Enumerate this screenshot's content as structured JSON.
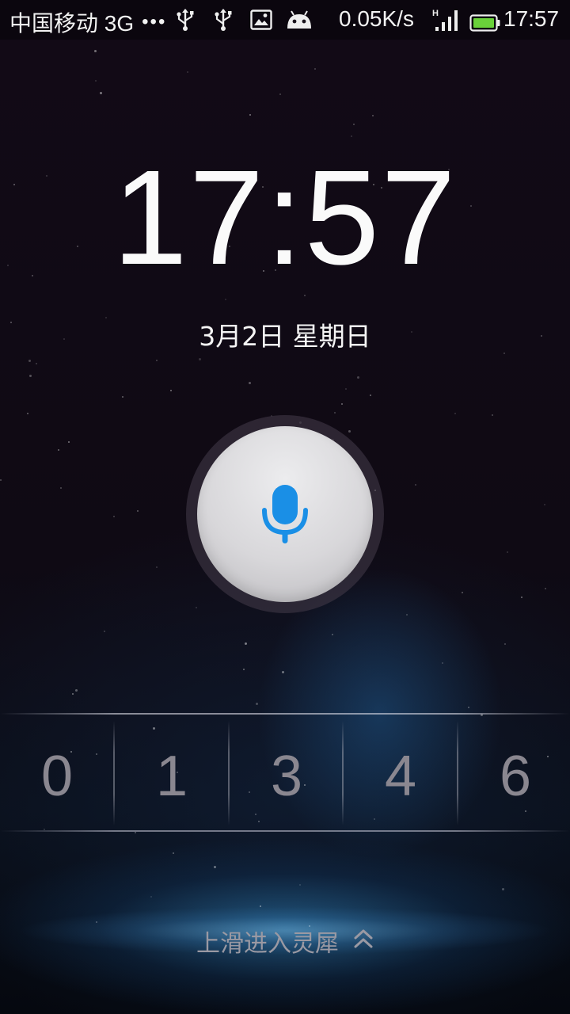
{
  "status_bar": {
    "carrier": "中国移动 3G",
    "more_dots": "•••",
    "network_speed": "0.05K/s",
    "network_type": "H",
    "time": "17:57",
    "icons": [
      "usb-icon",
      "usb-icon",
      "image-icon",
      "android-icon",
      "signal-icon",
      "battery-icon"
    ],
    "battery_color": "#6ad23a"
  },
  "lockscreen": {
    "clock": "17:57",
    "date": "3月2日 星期日",
    "mic_color": "#1a8fe6",
    "digits": [
      "0",
      "1",
      "3",
      "4",
      "6"
    ],
    "slide_hint": "上滑进入灵犀"
  }
}
